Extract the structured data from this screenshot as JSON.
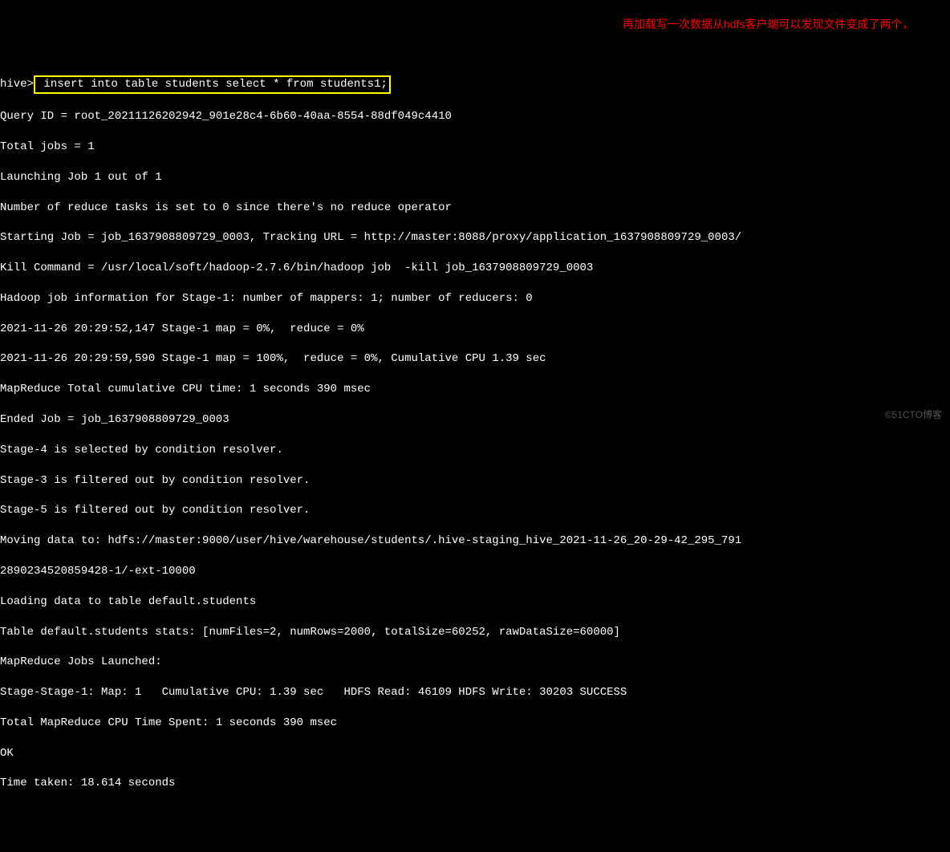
{
  "prompt": "hive>",
  "command": " insert into table students select * from students1;",
  "annotation": "再加载写一次数据从hdfs客户端可以发现文件变成了两个，",
  "lines": {
    "l1": "Query ID = root_20211126202942_901e28c4-6b60-40aa-8554-88df049c4410",
    "l2": "Total jobs = 1",
    "l3": "Launching Job 1 out of 1",
    "l4": "Number of reduce tasks is set to 0 since there's no reduce operator",
    "l5": "Starting Job = job_1637908809729_0003, Tracking URL = http://master:8088/proxy/application_1637908809729_0003/",
    "l6": "Kill Command = /usr/local/soft/hadoop-2.7.6/bin/hadoop job  -kill job_1637908809729_0003",
    "l7": "Hadoop job information for Stage-1: number of mappers: 1; number of reducers: 0",
    "l8": "2021-11-26 20:29:52,147 Stage-1 map = 0%,  reduce = 0%",
    "l9": "2021-11-26 20:29:59,590 Stage-1 map = 100%,  reduce = 0%, Cumulative CPU 1.39 sec",
    "l10": "MapReduce Total cumulative CPU time: 1 seconds 390 msec",
    "l11": "Ended Job = job_1637908809729_0003",
    "l12": "Stage-4 is selected by condition resolver.",
    "l13": "Stage-3 is filtered out by condition resolver.",
    "l14": "Stage-5 is filtered out by condition resolver.",
    "l15": "Moving data to: hdfs://master:9000/user/hive/warehouse/students/.hive-staging_hive_2021-11-26_20-29-42_295_791",
    "l16": "2890234520859428-1/-ext-10000",
    "l17": "Loading data to table default.students",
    "l18": "Table default.students stats: [numFiles=2, numRows=2000, totalSize=60252, rawDataSize=60000]",
    "l19": "MapReduce Jobs Launched:",
    "l20": "Stage-Stage-1: Map: 1   Cumulative CPU: 1.39 sec   HDFS Read: 46109 HDFS Write: 30203 SUCCESS",
    "l21": "Total MapReduce CPU Time Spent: 1 seconds 390 msec",
    "l22": "OK",
    "l23": "Time taken: 18.614 seconds"
  },
  "watermark": "©51CTO博客"
}
